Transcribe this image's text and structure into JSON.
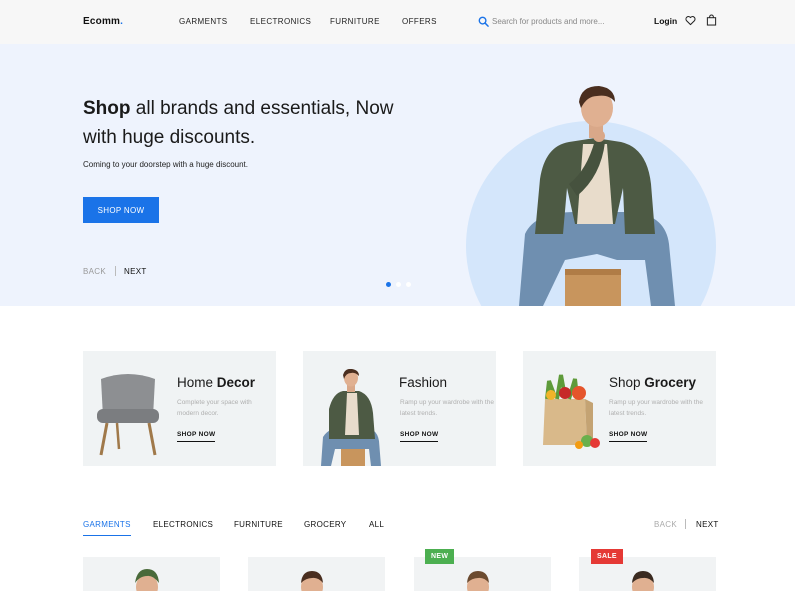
{
  "header": {
    "logo": "Ecomm",
    "logo_dot": ".",
    "nav": [
      "GARMENTS",
      "ELECTRONICS",
      "FURNITURE",
      "OFFERS"
    ],
    "search_placeholder": "Search for products and more...",
    "login": "Login",
    "icons": [
      "search-icon",
      "heart-icon",
      "bag-icon"
    ]
  },
  "hero": {
    "title_bold": "Shop",
    "title_rest": " all brands and essentials, Now with huge discounts.",
    "subtitle": "Coming to your doorstep with a huge discount.",
    "cta": "SHOP NOW",
    "back": "BACK",
    "next": "NEXT",
    "slide_count": 3,
    "active_slide": 1
  },
  "categories": [
    {
      "title_plain": "Home ",
      "title_bold": "Decor",
      "desc": "Complete your space with modern decor.",
      "link": "SHOP NOW"
    },
    {
      "title_plain": "Fashion",
      "title_bold": "",
      "desc": "Ramp up your wardrobe with the latest trends.",
      "link": "SHOP NOW"
    },
    {
      "title_plain": "Shop ",
      "title_bold": "Grocery",
      "desc": "Ramp up your wardrobe with the latest trends.",
      "link": "SHOP NOW"
    }
  ],
  "products": {
    "tabs": [
      "GARMENTS",
      "ELECTRONICS",
      "FURNITURE",
      "GROCERY",
      "ALL"
    ],
    "active_tab": "GARMENTS",
    "back": "BACK",
    "next": "NEXT",
    "badges": [
      "NEW",
      "SALE"
    ]
  },
  "colors": {
    "accent": "#1a73e8",
    "hero_bg": "#eef3fd",
    "hero_circle": "#d4e6fb",
    "card_bg": "#f0f3f4",
    "badge_new": "#4caf50",
    "badge_sale": "#e53935"
  }
}
